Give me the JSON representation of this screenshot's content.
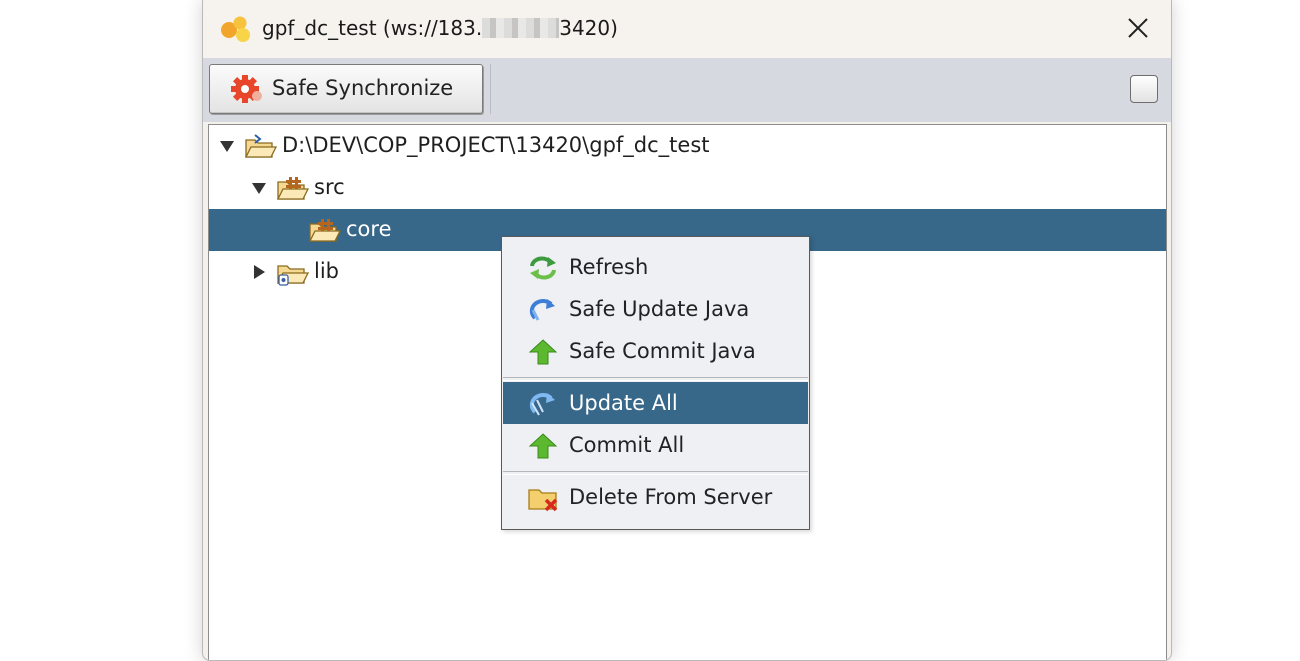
{
  "window": {
    "title_prefix": "gpf_dc_test (ws://183.",
    "title_suffix": "3420)",
    "close_symbol": "✕"
  },
  "toolbar": {
    "sync_label": "Safe Synchronize",
    "sync_icon": "gear-sync-icon"
  },
  "tree": {
    "root_label": "D:\\DEV\\COP_PROJECT\\13420\\gpf_dc_test",
    "src_label": "src",
    "core_label": "core",
    "lib_label": "lib"
  },
  "context_menu": {
    "items": [
      {
        "label": "Refresh",
        "icon": "refresh-icon"
      },
      {
        "label": "Safe Update Java",
        "icon": "update-java-icon"
      },
      {
        "label": "Safe Commit Java",
        "icon": "commit-java-icon"
      },
      {
        "label": "Update All",
        "icon": "update-all-icon"
      },
      {
        "label": "Commit All",
        "icon": "commit-all-icon"
      },
      {
        "label": "Delete From Server",
        "icon": "delete-from-server-icon"
      }
    ],
    "active_item": "Update All"
  },
  "colors": {
    "selection": "#376789",
    "toolbar_bg": "#d6d9df",
    "menu_bg": "#eef0f4"
  }
}
